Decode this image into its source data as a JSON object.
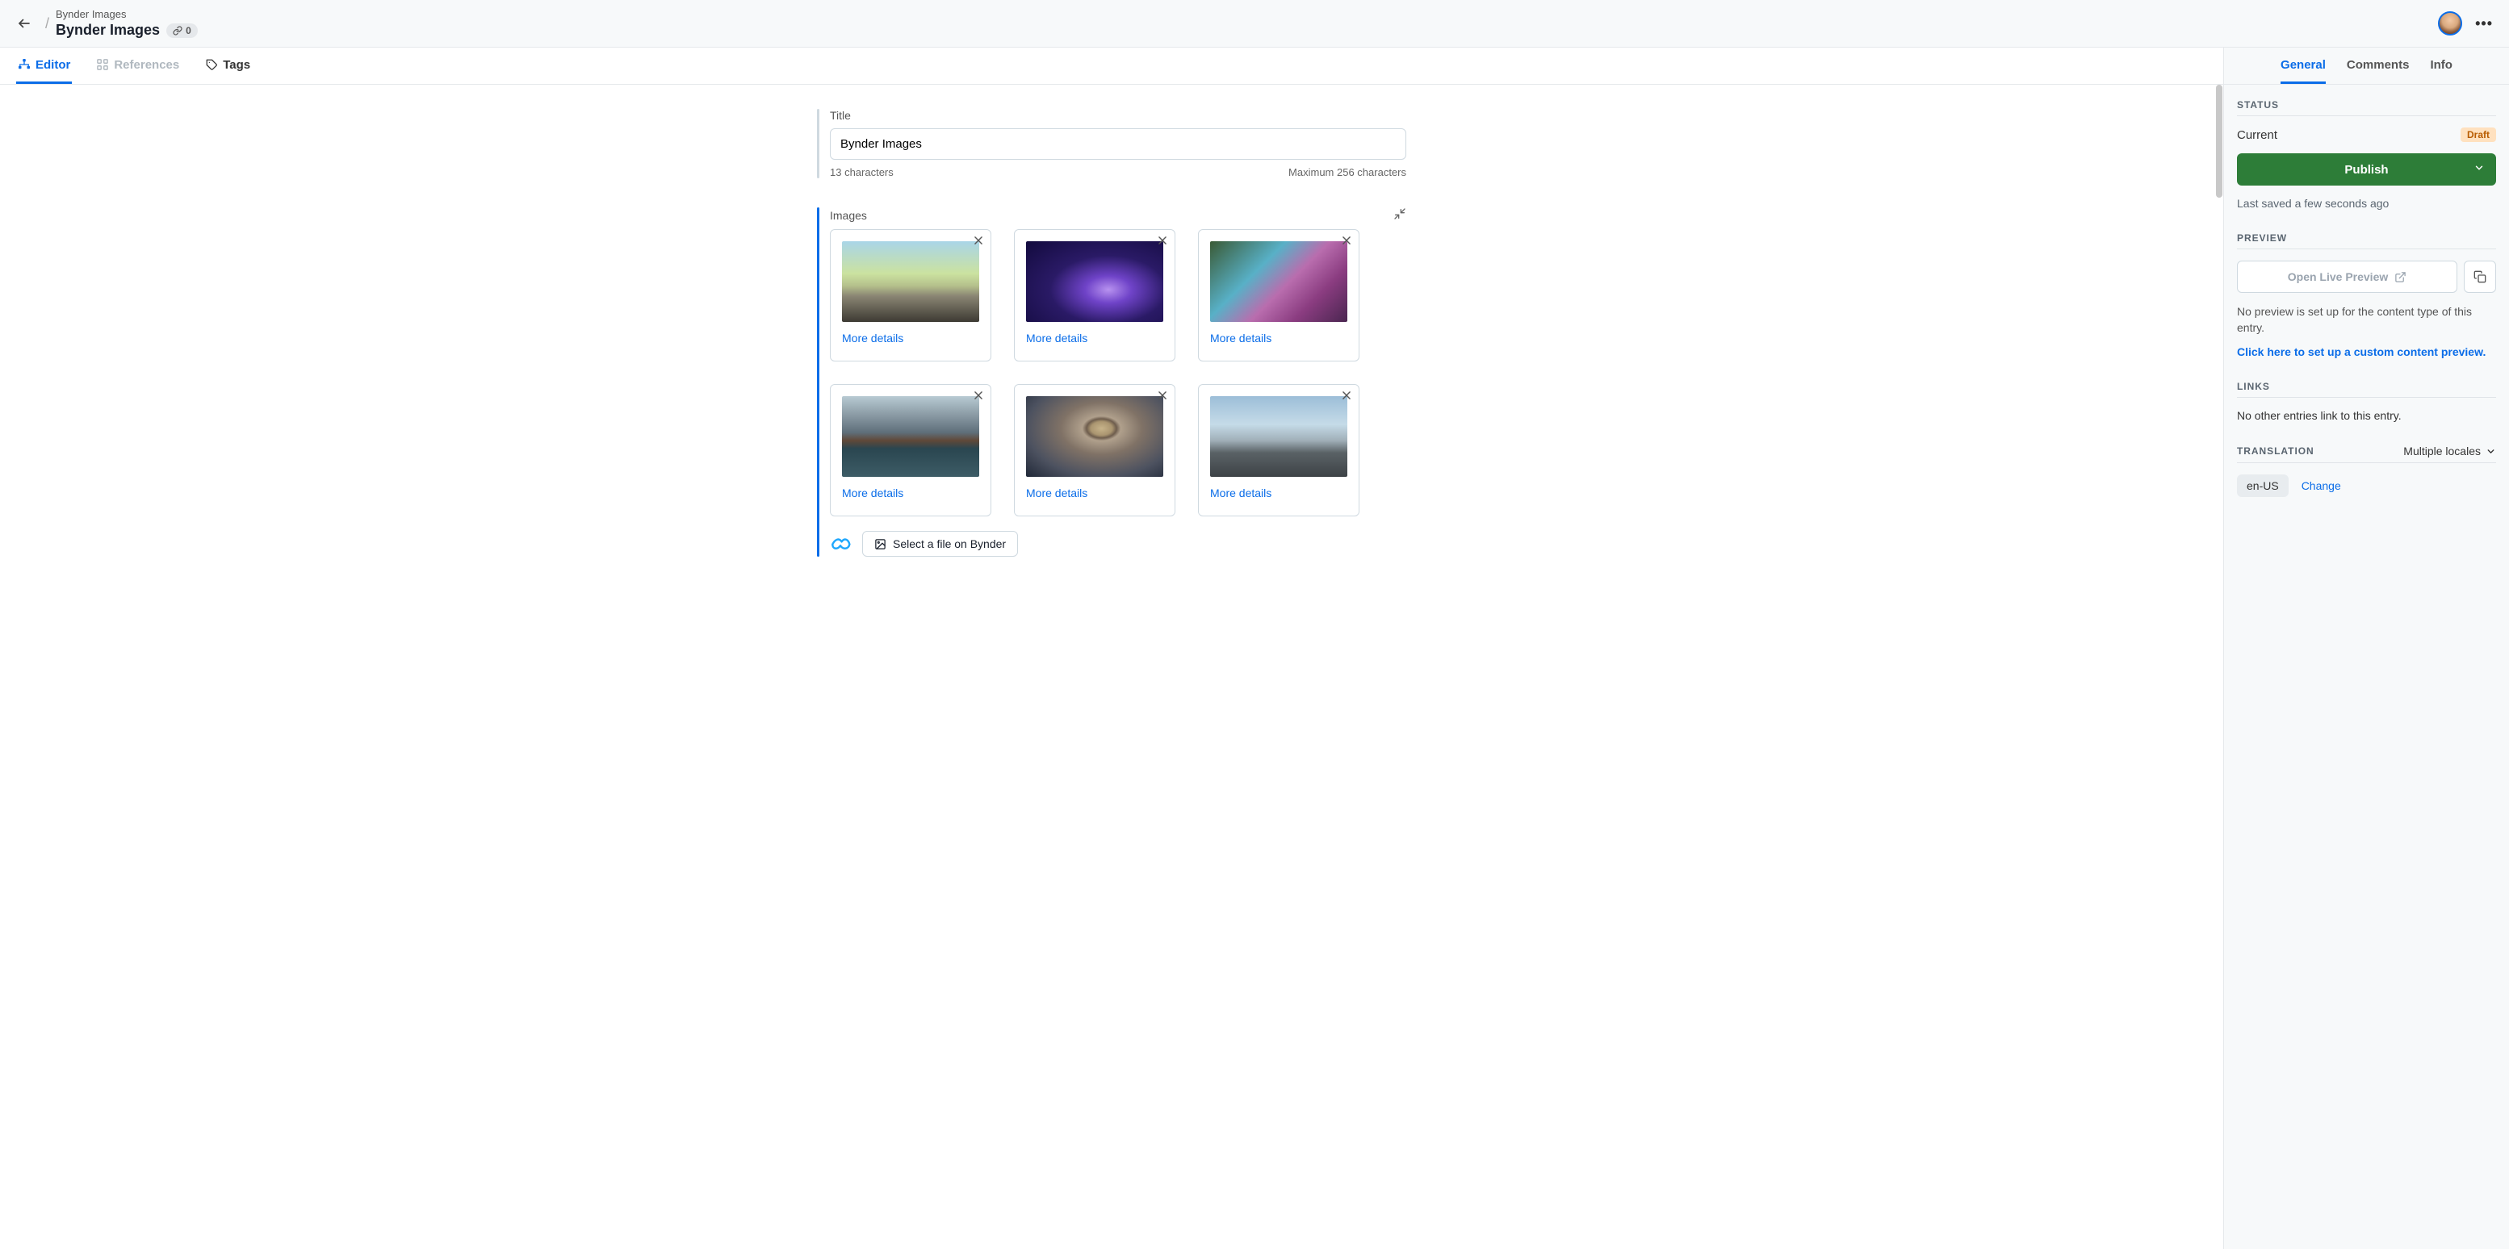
{
  "header": {
    "content_type": "Bynder Images",
    "title": "Bynder Images",
    "ref_count": "0"
  },
  "tabs": {
    "editor": "Editor",
    "references": "References",
    "tags": "Tags"
  },
  "fields": {
    "title": {
      "label": "Title",
      "value": "Bynder Images",
      "char_count": "13 characters",
      "max": "Maximum 256 characters"
    },
    "images": {
      "label": "Images",
      "more_details": "More details",
      "select_label": "Select a file on Bynder"
    }
  },
  "sidebar": {
    "tabs": {
      "general": "General",
      "comments": "Comments",
      "info": "Info"
    },
    "status": {
      "heading": "STATUS",
      "current_label": "Current",
      "badge": "Draft",
      "publish": "Publish",
      "saved": "Last saved a few seconds ago"
    },
    "preview": {
      "heading": "PREVIEW",
      "button": "Open Live Preview",
      "desc": "No preview is set up for the content type of this entry.",
      "link": "Click here to set up a custom content preview."
    },
    "links": {
      "heading": "LINKS",
      "desc": "No other entries link to this entry."
    },
    "translation": {
      "heading": "TRANSLATION",
      "multiple": "Multiple locales",
      "locale": "en-US",
      "change": "Change"
    }
  }
}
